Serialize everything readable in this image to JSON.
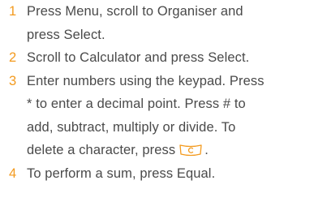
{
  "steps": [
    {
      "number": "1",
      "lines": [
        "Press Menu, scroll to Organiser and",
        "press Select."
      ]
    },
    {
      "number": "2",
      "lines": [
        "Scroll to Calculator and press Select."
      ]
    },
    {
      "number": "3",
      "lines": [
        "Enter numbers using the keypad. Press",
        "* to enter a decimal point. Press # to",
        "add, subtract, multiply or divide. To",
        "delete a character, press"
      ],
      "trailing": ".",
      "inline_icon": "clear-key-icon"
    },
    {
      "number": "4",
      "lines": [
        "To perform a sum, press Equal."
      ]
    }
  ],
  "colors": {
    "number": "#f39a1e",
    "text": "#4a4a4a"
  }
}
